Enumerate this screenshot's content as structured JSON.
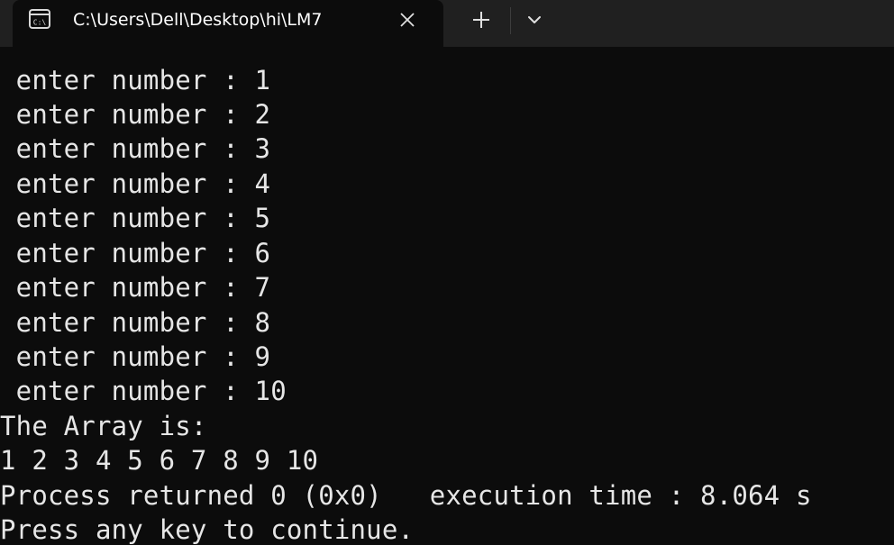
{
  "tab": {
    "title": "C:\\Users\\Dell\\Desktop\\hi\\LM7",
    "icon": "console-icon",
    "close_icon": "close-icon"
  },
  "toolbar": {
    "new_tab_icon": "plus-icon",
    "dropdown_icon": "chevron-down-icon"
  },
  "console": {
    "lines": [
      " enter number : 1",
      " enter number : 2",
      " enter number : 3",
      " enter number : 4",
      " enter number : 5",
      " enter number : 6",
      " enter number : 7",
      " enter number : 8",
      " enter number : 9",
      " enter number : 10",
      "The Array is:",
      "1 2 3 4 5 6 7 8 9 10",
      "Process returned 0 (0x0)   execution time : 8.064 s",
      "Press any key to continue."
    ]
  },
  "colors": {
    "background": "#0c0c0c",
    "tabbar": "#202020",
    "text": "#e6e6e6"
  }
}
